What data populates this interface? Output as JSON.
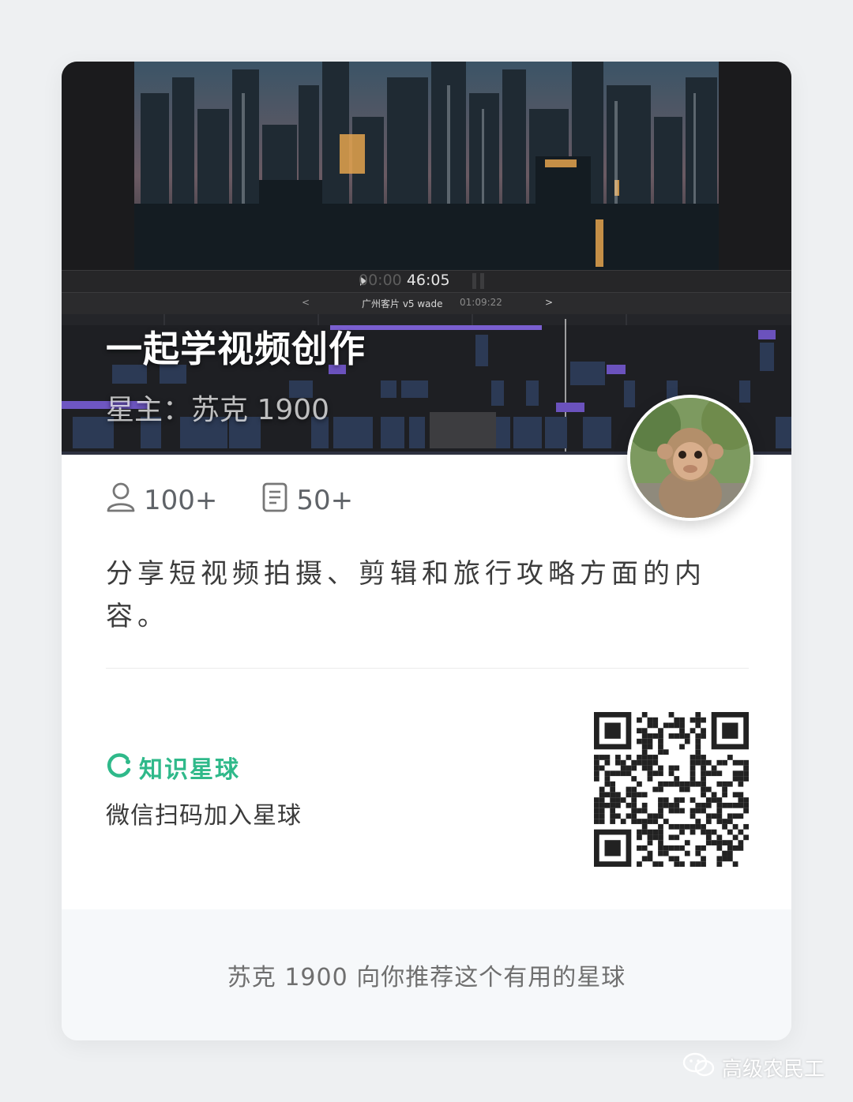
{
  "cover": {
    "title": "一起学视频创作",
    "owner": "星主：苏克 1900",
    "editor": {
      "timecode_dim": "00:00",
      "timecode": "46:05",
      "project_name": "广州客片 v5 wade",
      "project_time": "01:09:22"
    }
  },
  "stats": {
    "members": "100+",
    "posts": "50+",
    "members_icon": "user-icon",
    "posts_icon": "document-icon"
  },
  "description": "分享短视频拍摄、剪辑和旅行攻略方面的内容。",
  "brand": {
    "name": "知识星球",
    "icon": "planet-logo-icon",
    "color": "#2fb98a"
  },
  "scan_text": "微信扫码加入星球",
  "footer": "苏克 1900 向你推荐这个有用的星球",
  "watermark": "高级农民工"
}
